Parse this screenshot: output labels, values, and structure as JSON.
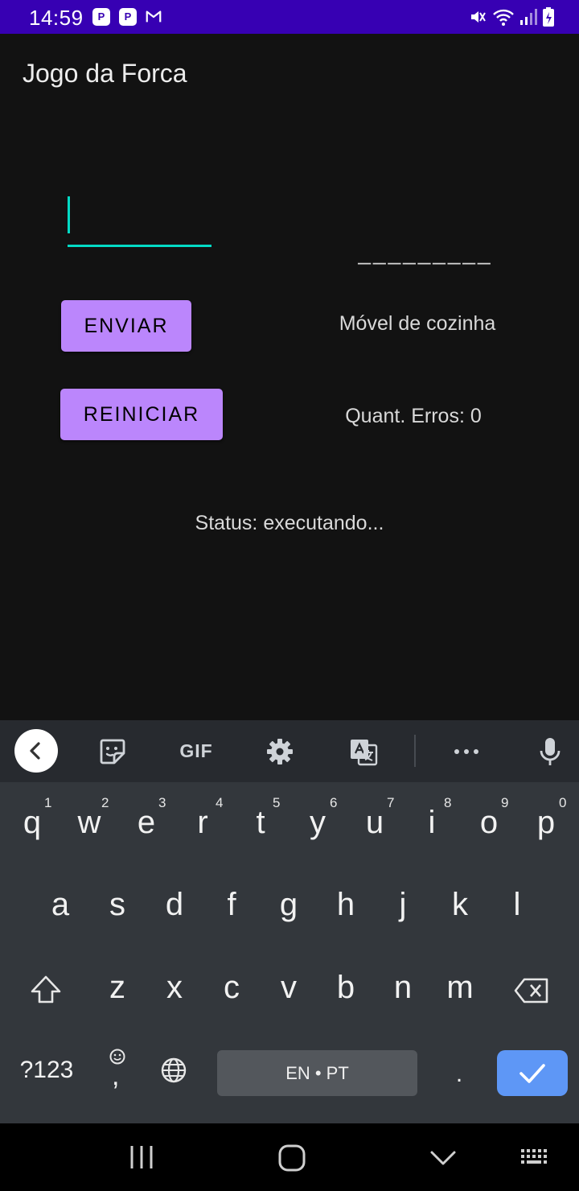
{
  "status_bar": {
    "time": "14:59",
    "notification_icons": [
      "p-icon",
      "p-icon",
      "gmail-icon"
    ],
    "system_icons": [
      "mute-icon",
      "wifi-icon",
      "signal-icon",
      "battery-icon"
    ]
  },
  "app": {
    "title": "Jogo da Forca"
  },
  "game": {
    "letter_input_value": "",
    "word_mask": "_________",
    "send_button_label": "ENVIAR",
    "restart_button_label": "REINICIAR",
    "hint": "Móvel de cozinha",
    "errors": "Quant. Erros: 0",
    "status": "Status: executando..."
  },
  "keyboard": {
    "toolbar": {
      "gif_label": "GIF"
    },
    "row1": [
      "q",
      "w",
      "e",
      "r",
      "t",
      "y",
      "u",
      "i",
      "o",
      "p"
    ],
    "row1_numbers": [
      "1",
      "2",
      "3",
      "4",
      "5",
      "6",
      "7",
      "8",
      "9",
      "0"
    ],
    "row2": [
      "a",
      "s",
      "d",
      "f",
      "g",
      "h",
      "j",
      "k",
      "l"
    ],
    "row3": [
      "z",
      "x",
      "c",
      "v",
      "b",
      "n",
      "m"
    ],
    "symbols_label": "?123",
    "comma_label": ",",
    "space_label": "EN • PT",
    "period_label": "."
  },
  "colors": {
    "status_bar": "#3700b3",
    "accent": "#03dac5",
    "button": "#bb86fc",
    "background": "#121212",
    "enter_key": "#5e97f6"
  }
}
